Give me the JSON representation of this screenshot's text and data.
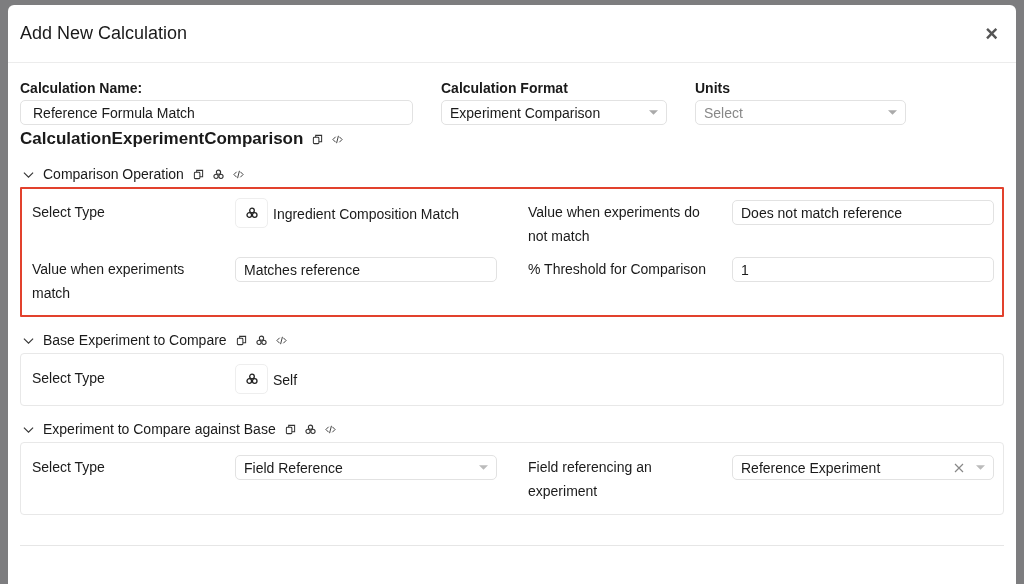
{
  "dialog": {
    "title": "Add New Calculation",
    "close": "×"
  },
  "fields": [
    {
      "label": "Calculation Name:",
      "kind": "text",
      "value": "Reference Formula Match"
    },
    {
      "label": "Calculation Format",
      "kind": "select",
      "value": "Experiment Comparison"
    },
    {
      "label": "Units",
      "kind": "select",
      "placeholder": "Select"
    }
  ],
  "class_name": "CalculationExperimentComparison",
  "sections": [
    {
      "title": "Comparison Operation",
      "expanded": true,
      "highlighted": true,
      "items": [
        {
          "label": "Select Type",
          "kind": "type",
          "value": "Ingredient Composition Match"
        },
        {
          "label": "Value when experiments do not match",
          "kind": "text",
          "value": "Does not match reference"
        },
        {
          "label": "Value when experiments match",
          "kind": "text",
          "value": "Matches reference"
        },
        {
          "label": "% Threshold for Comparison",
          "kind": "text",
          "value": "1"
        }
      ]
    },
    {
      "title": "Base Experiment to Compare",
      "expanded": true,
      "highlighted": false,
      "items": [
        {
          "label": "Select Type",
          "kind": "type",
          "value": "Self"
        }
      ]
    },
    {
      "title": "Experiment to Compare against Base",
      "expanded": true,
      "highlighted": false,
      "items": [
        {
          "label": "Select Type",
          "kind": "select",
          "value": "Field Reference",
          "clearable": false
        },
        {
          "label": "Field referencing an experiment",
          "kind": "select",
          "value": "Reference Experiment",
          "clearable": true
        }
      ]
    }
  ]
}
